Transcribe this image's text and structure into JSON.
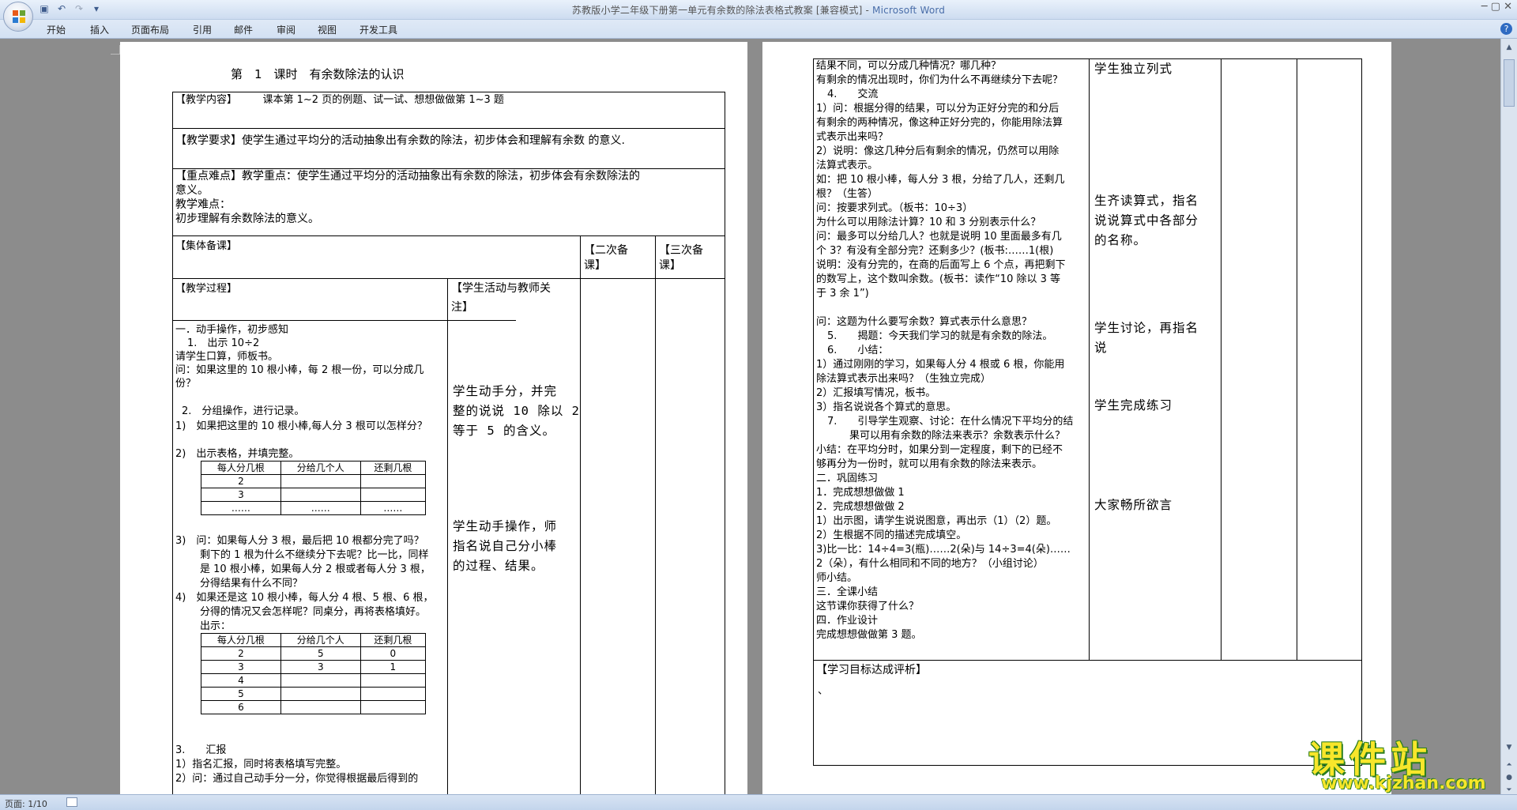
{
  "window": {
    "title": "苏教版小学二年级下册第一单元有余数的除法表格式教案 [兼容模式] - ",
    "app_name": "Microsoft Word"
  },
  "qat": {
    "undo_arrow": "↶",
    "redo_arrow": "↷"
  },
  "tabs": [
    "开始",
    "插入",
    "页面布局",
    "引用",
    "邮件",
    "审阅",
    "视图",
    "开发工具"
  ],
  "status": {
    "page": "页面: 1/10"
  },
  "doc": {
    "title": "第　1　课时　有余数除法的认识",
    "content": "【教学内容】　　　课本第 1~2 页的例题、试一试、想想做做第 1~3 题",
    "requirement": "【教学要求】使学生通过平均分的活动抽象出有余数的除法，初步体会和理解有余数 的意义.",
    "keypoints": [
      "【重点难点】教学重点：使学生通过平均分的活动抽象出有余数的除法，初步体会有余数除法的",
      "意义。",
      "教学难点：",
      "初步理解有余数除法的意义。"
    ],
    "collective": "【集体备课】",
    "second_prep": [
      "【二次备",
      "课】"
    ],
    "third_prep": [
      "【三次备",
      "课】"
    ],
    "process_header": "【教学过程】",
    "activity_header": [
      "【学生活动与教师关",
      "注】"
    ],
    "left_lines": [
      "一．动手操作，初步感知",
      "1.　出示 10÷2",
      "请学生口算，师板书。",
      "问：如果这里的 10 根小棒，每 2 根一份，可以分成几",
      "份？",
      "2.　分组操作，进行记录。",
      "1)　如果把这里的 10 根小棒,每人分 3 根可以怎样分？",
      "2)　出示表格，并填完整。",
      "3)　问：如果每人分 3 根，最后把 10 根都分完了吗？",
      "剩下的 1 根为什么不继续分下去呢？比一比，同样",
      "是 10 根小棒，如果每人分 2 根或者每人分 3 根，",
      "分得结果有什么不同？",
      "4)　如果还是这 10 根小棒，每人分 4 根、5 根、6 根，",
      "分得的情况又会怎样呢？同桌分，再将表格填好。",
      "出示：",
      "3.　　汇报",
      "1）指名汇报，同时将表格填写完整。",
      "2）问：通过自己动手分一分，你觉得根据最后得到的"
    ],
    "table1": {
      "headers": [
        "每人分几根",
        "分给几个人",
        "还剩几根"
      ],
      "rows": [
        [
          "2",
          "",
          ""
        ],
        [
          "3",
          "",
          ""
        ],
        [
          "……",
          "……",
          "……"
        ]
      ]
    },
    "table2": {
      "headers": [
        "每人分几根",
        "分给几个人",
        "还剩几根"
      ],
      "rows": [
        [
          "2",
          "5",
          "0"
        ],
        [
          "3",
          "3",
          "1"
        ],
        [
          "4",
          "",
          ""
        ],
        [
          "5",
          "",
          ""
        ],
        [
          "6",
          "",
          ""
        ]
      ]
    },
    "p1_activity": [
      [
        "学生动手分，并完",
        "整的说说 10 除以 2",
        "等于 5 的含义。"
      ],
      [
        "学生动手操作，师",
        "指名说自己分小棒",
        "的过程、结果。"
      ]
    ],
    "right_lines": [
      "结果不同，可以分成几种情况？哪几种？",
      "有剩余的情况出现时，你们为什么不再继续分下去呢？",
      "4.　　交流",
      "1）问：根据分得的结果，可以分为正好分完的和分后",
      "有剩余的两种情况，像这种正好分完的，你能用除法算",
      "式表示出来吗？",
      "2）说明：像这几种分后有剩余的情况，仍然可以用除",
      "法算式表示。",
      "如：把 10 根小棒，每人分 3 根，分给了几人，还剩几",
      "根？（生答）",
      "问：按要求列式。（板书：10÷3）",
      "为什么可以用除法计算？10 和 3 分别表示什么？",
      "问：最多可以分给几人？也就是说明 10 里面最多有几",
      "个 3？有没有全部分完？还剩多少？(板书:……1(根)",
      "说明：没有分完的，在商的后面写上 6 个点，再把剩下",
      "的数写上，这个数叫余数。(板书：读作“10 除以 3 等",
      "于 3 余 1”)",
      "问：这题为什么要写余数？算式表示什么意思？",
      "5.　　揭题：今天我们学习的就是有余数的除法。",
      "6.　　小结：",
      "1）通过刚刚的学习，如果每人分 4 根或 6 根，你能用",
      "除法算式表示出来吗？（生独立完成）",
      "2）汇报填写情况，板书。",
      "3）指名说说各个算式的意思。",
      "7.　　引导学生观察、讨论：在什么情况下平均分的结",
      "果可以用有余数的除法来表示？余数表示什么？",
      "小结：在平均分时，如果分到一定程度，剩下的已经不",
      "够再分为一份时，就可以用有余数的除法来表示。",
      "二．巩固练习",
      "1．完成想想做做 1",
      "2．完成想想做做 2",
      "1）出示图，请学生说说图意，再出示（1）（2）题。",
      "2）生根据不同的描述完成填空。",
      "3)比一比：14÷4=3(瓶)……2(朵)与 14÷3=4(朵)……",
      "2（朵），有什么相同和不同的地方？（小组讨论）",
      "师小结。",
      "三．全课小结",
      "这节课你获得了什么？",
      "四．作业设计",
      "完成想想做做第 3 题。"
    ],
    "p2_activity": [
      [
        "学生独立列式"
      ],
      [
        "生齐读算式，指名",
        "说说算式中各部分",
        "的名称。"
      ],
      [
        "学生讨论，再指名",
        "说"
      ],
      [
        "学生完成练习"
      ],
      [
        "大家畅所欲言"
      ]
    ],
    "evaluation": "【学习目标达成评析】",
    "evaluation_bullet": "、"
  },
  "watermark": {
    "text": "课件站",
    "url": "www.kjzhan.com"
  }
}
